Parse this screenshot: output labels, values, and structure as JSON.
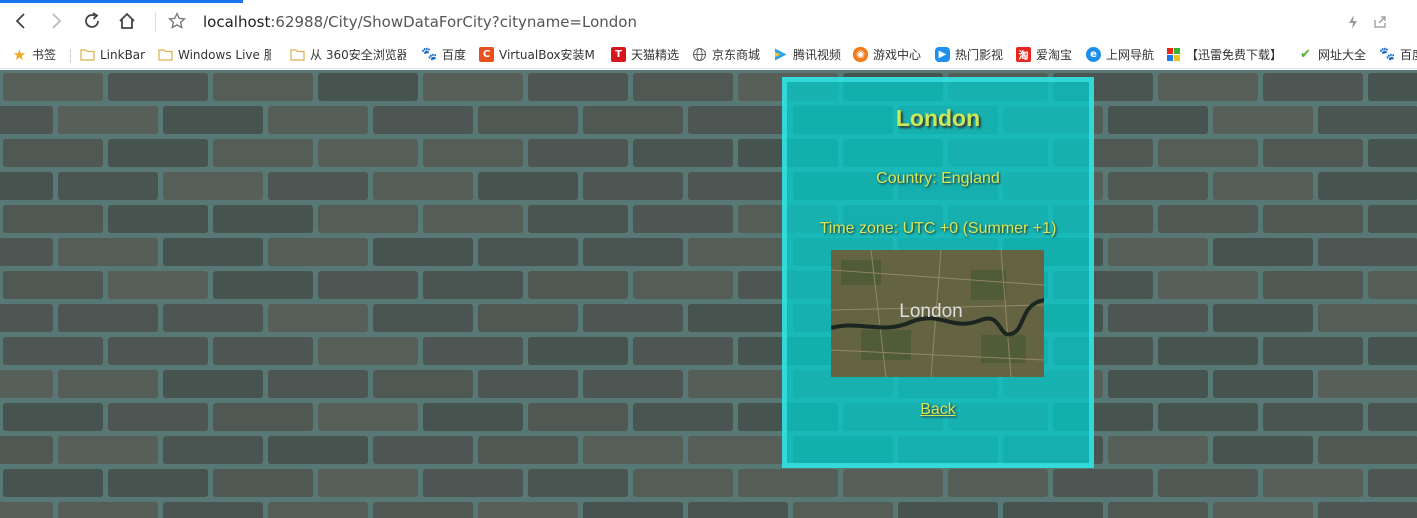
{
  "browser": {
    "address": {
      "host": "localhost",
      "path": ":62988/City/ShowDataForCity?cityname=London"
    },
    "icons": [
      "back-icon",
      "forward-icon",
      "reload-icon",
      "home-icon",
      "star-icon",
      "lightning-icon",
      "share-icon"
    ]
  },
  "bookmarks": [
    {
      "label": "书签",
      "icon": "star-icon",
      "color": "#f5a623"
    },
    {
      "label": "LinkBar",
      "icon": "folder-icon",
      "color": "#e8c35a"
    },
    {
      "label": "Windows Live 服",
      "icon": "folder-icon",
      "color": "#e8c35a"
    },
    {
      "label": "从 360安全浏览器",
      "icon": "folder-icon",
      "color": "#e8c35a"
    },
    {
      "label": "百度",
      "icon": "baidu-icon",
      "color": "#2b5fd9"
    },
    {
      "label": "VirtualBox安装M",
      "icon": "c-icon",
      "color": "#e8501f"
    },
    {
      "label": "天猫精选",
      "icon": "tmall-icon",
      "color": "#d8141c"
    },
    {
      "label": "京东商城",
      "icon": "globe-icon",
      "color": "#666666"
    },
    {
      "label": "腾讯视频",
      "icon": "play-icon",
      "color": "#25a3f5"
    },
    {
      "label": "游戏中心",
      "icon": "gamepad-icon",
      "color": "#f07c1e"
    },
    {
      "label": "热门影视",
      "icon": "video-icon",
      "color": "#1f8ff0"
    },
    {
      "label": "爱淘宝",
      "icon": "taobao-icon",
      "color": "#e8261e"
    },
    {
      "label": "上网导航",
      "icon": "nav-icon",
      "color": "#1d8fe8"
    },
    {
      "label": "【迅雷免费下载】",
      "icon": "windows-icon",
      "color": "#e8c31e"
    },
    {
      "label": "网址大全",
      "icon": "hao-icon",
      "color": "#55b030"
    },
    {
      "label": "百度",
      "icon": "baidu-icon",
      "color": "#2b5fd9"
    }
  ],
  "city": {
    "name": "London",
    "country": "Country: England",
    "timezone": "Time zone: UTC +0 (Summer +1)",
    "map_label": "London",
    "back_label": "Back"
  },
  "colors": {
    "card": "#00d2d2",
    "text": "#d6e85a",
    "progress": "#1a73e8"
  }
}
